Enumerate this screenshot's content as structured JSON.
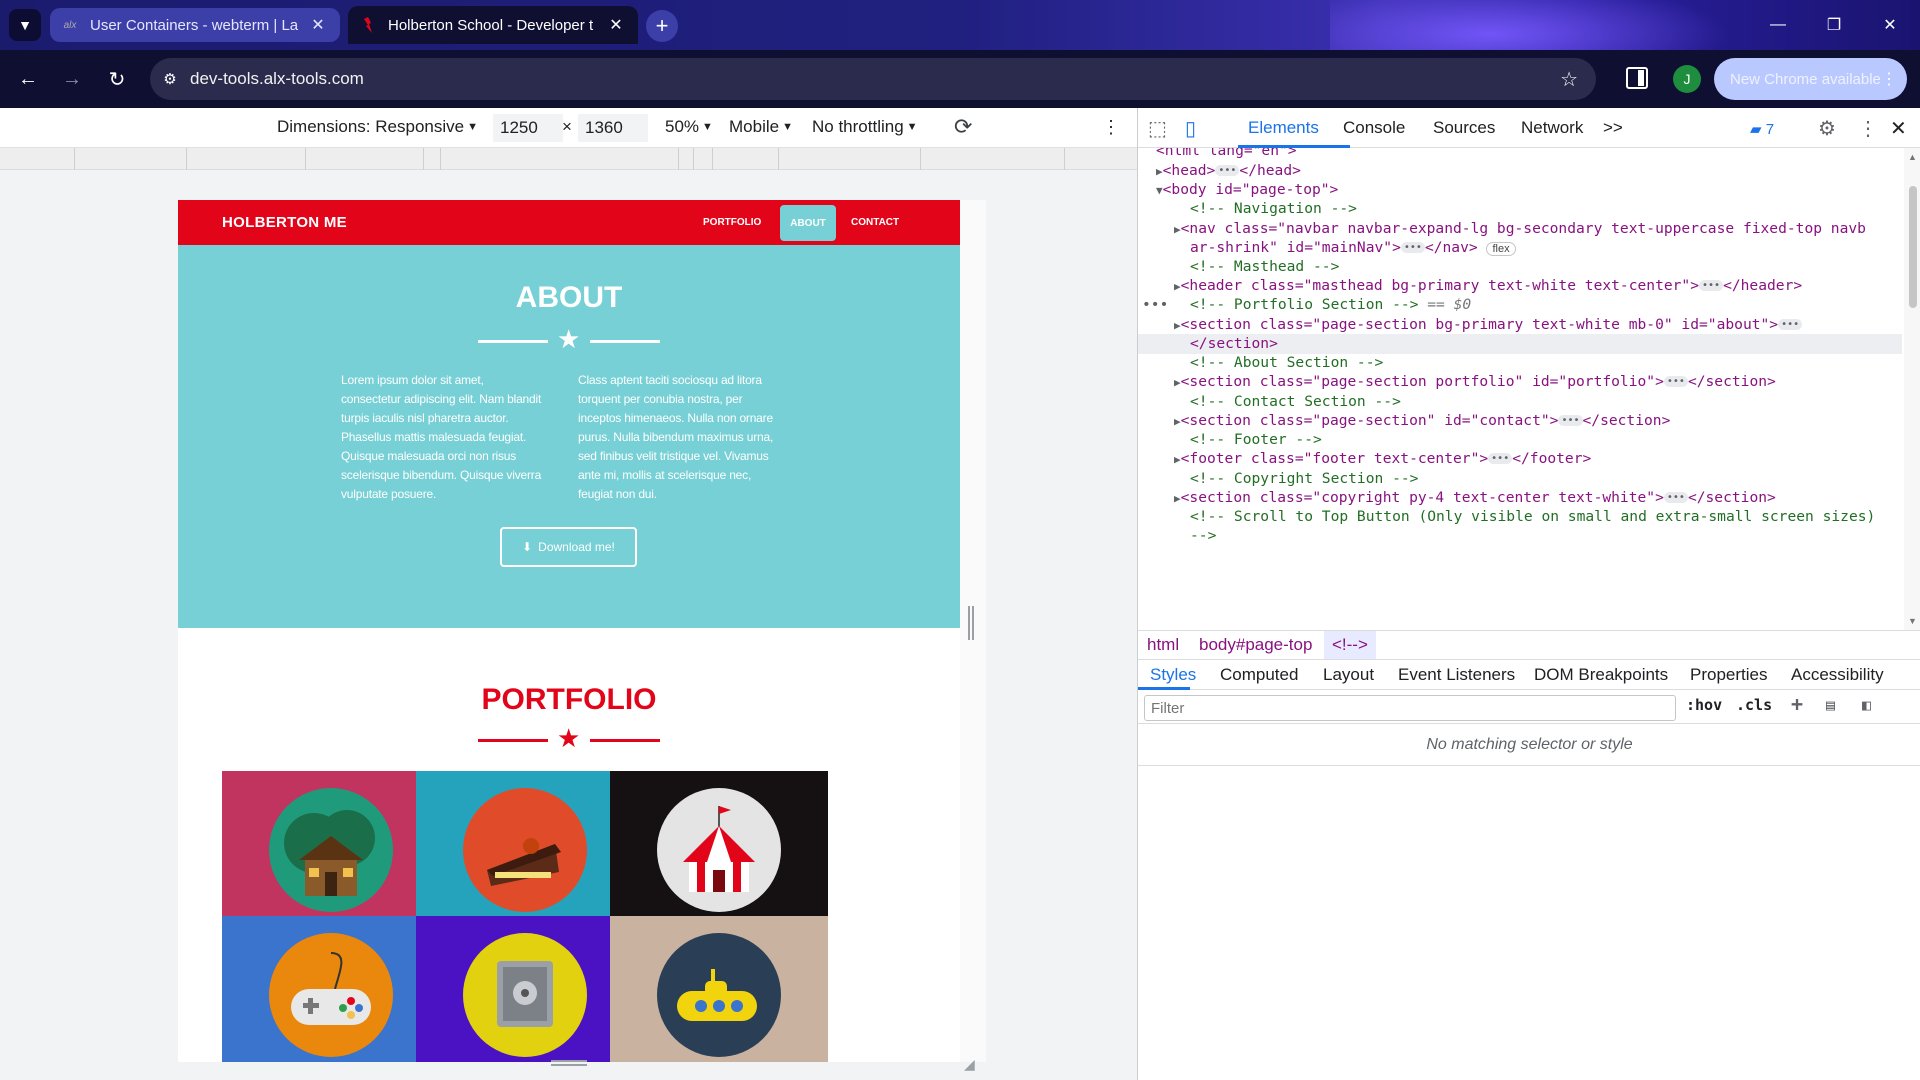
{
  "browser": {
    "tabs": [
      {
        "title": "User Containers - webterm | La",
        "favicon": "alx",
        "active": false
      },
      {
        "title": "Holberton School - Developer t",
        "favicon": "holberton",
        "active": true
      }
    ],
    "url": "dev-tools.alx-tools.com",
    "profile_initial": "J",
    "update_label": "New Chrome available"
  },
  "device_toolbar": {
    "dimensions_label": "Dimensions: Responsive",
    "width": "1250",
    "times": "×",
    "height": "1360",
    "zoom": "50%",
    "device_type": "Mobile",
    "throttle": "No throttling"
  },
  "page": {
    "brand": "HOLBERTON ME",
    "nav": [
      "PORTFOLIO",
      "ABOUT",
      "CONTACT"
    ],
    "about": {
      "heading": "ABOUT",
      "col1": "Lorem ipsum dolor sit amet, consectetur adipiscing elit. Nam blandit turpis iaculis nisl pharetra auctor. Phasellus mattis malesuada feugiat. Quisque malesuada orci non risus scelerisque bibendum. Quisque viverra vulputate posuere.",
      "col2": "Class aptent taciti sociosqu ad litora torquent per conubia nostra, per inceptos himenaeos. Nulla non ornare purus. Nulla bibendum maximus urna, sed finibus velit tristique vel. Vivamus ante mi, mollis at scelerisque nec, feugiat non dui.",
      "button": "Download me!"
    },
    "portfolio": {
      "heading": "PORTFOLIO",
      "tiles": [
        {
          "icon": "cabin-icon",
          "bg": "#c0345f",
          "disc": "#1f9b7c"
        },
        {
          "icon": "cake-icon",
          "bg": "#25a3bd",
          "disc": "#e04c2a"
        },
        {
          "icon": "circus-tent-icon",
          "bg": "#151113",
          "disc": "#e4e4e4"
        },
        {
          "icon": "game-controller-icon",
          "bg": "#3b74cc",
          "disc": "#e9880c"
        },
        {
          "icon": "safe-icon",
          "bg": "#4b12c4",
          "disc": "#e2d10e"
        },
        {
          "icon": "submarine-icon",
          "bg": "#c9b2a0",
          "disc": "#2a3f55"
        }
      ]
    }
  },
  "devtools": {
    "tabs": [
      "Elements",
      "Console",
      "Sources",
      "Network"
    ],
    "more": ">>",
    "issues_count": "7",
    "dom": {
      "html_line": "<html lang=\"en\">",
      "head": [
        "<head>",
        "</head>"
      ],
      "body_open": "<body id=\"page-top\">",
      "c_nav": "<!-- Navigation -->",
      "nav_l1": "<nav class=\"navbar navbar-expand-lg bg-secondary text-uppercase fixed-top navb",
      "nav_l2a": "ar-shrink\" id=\"mainNav\">",
      "nav_close": "</nav>",
      "nav_badge": "flex",
      "c_masthead": "<!-- Masthead -->",
      "header_open": "<header class=\"masthead bg-primary text-white text-center\">",
      "header_close": "</header>",
      "c_portfolio": "<!-- Portfolio Section -->",
      "dollar": "== $0",
      "sec_about_open": "<section class=\"page-section bg-primary text-white mb-0\" id=\"about\">",
      "sec_close": "</section>",
      "c_about": "<!-- About Section -->",
      "sec_portfolio_open": "<section class=\"page-section portfolio\" id=\"portfolio\">",
      "c_contact": "<!-- Contact Section -->",
      "sec_contact_open": "<section class=\"page-section\" id=\"contact\">",
      "c_footer": "<!-- Footer -->",
      "footer_open": "<footer class=\"footer text-center\">",
      "footer_close": "</footer>",
      "c_copyright": "<!-- Copyright Section -->",
      "sec_copy_open": "<section class=\"copyright py-4 text-center text-white\">",
      "c_scroll1": "<!-- Scroll to Top Button (Only visible on small and extra-small screen sizes)",
      "c_scroll2": "-->"
    },
    "breadcrumbs": [
      "html",
      "body#page-top",
      "<!-->"
    ],
    "panel_tabs": [
      "Styles",
      "Computed",
      "Layout",
      "Event Listeners",
      "DOM Breakpoints",
      "Properties",
      "Accessibility"
    ],
    "filter_placeholder": "Filter",
    "hov": ":hov",
    "cls": ".cls",
    "no_match": "No matching selector or style"
  }
}
